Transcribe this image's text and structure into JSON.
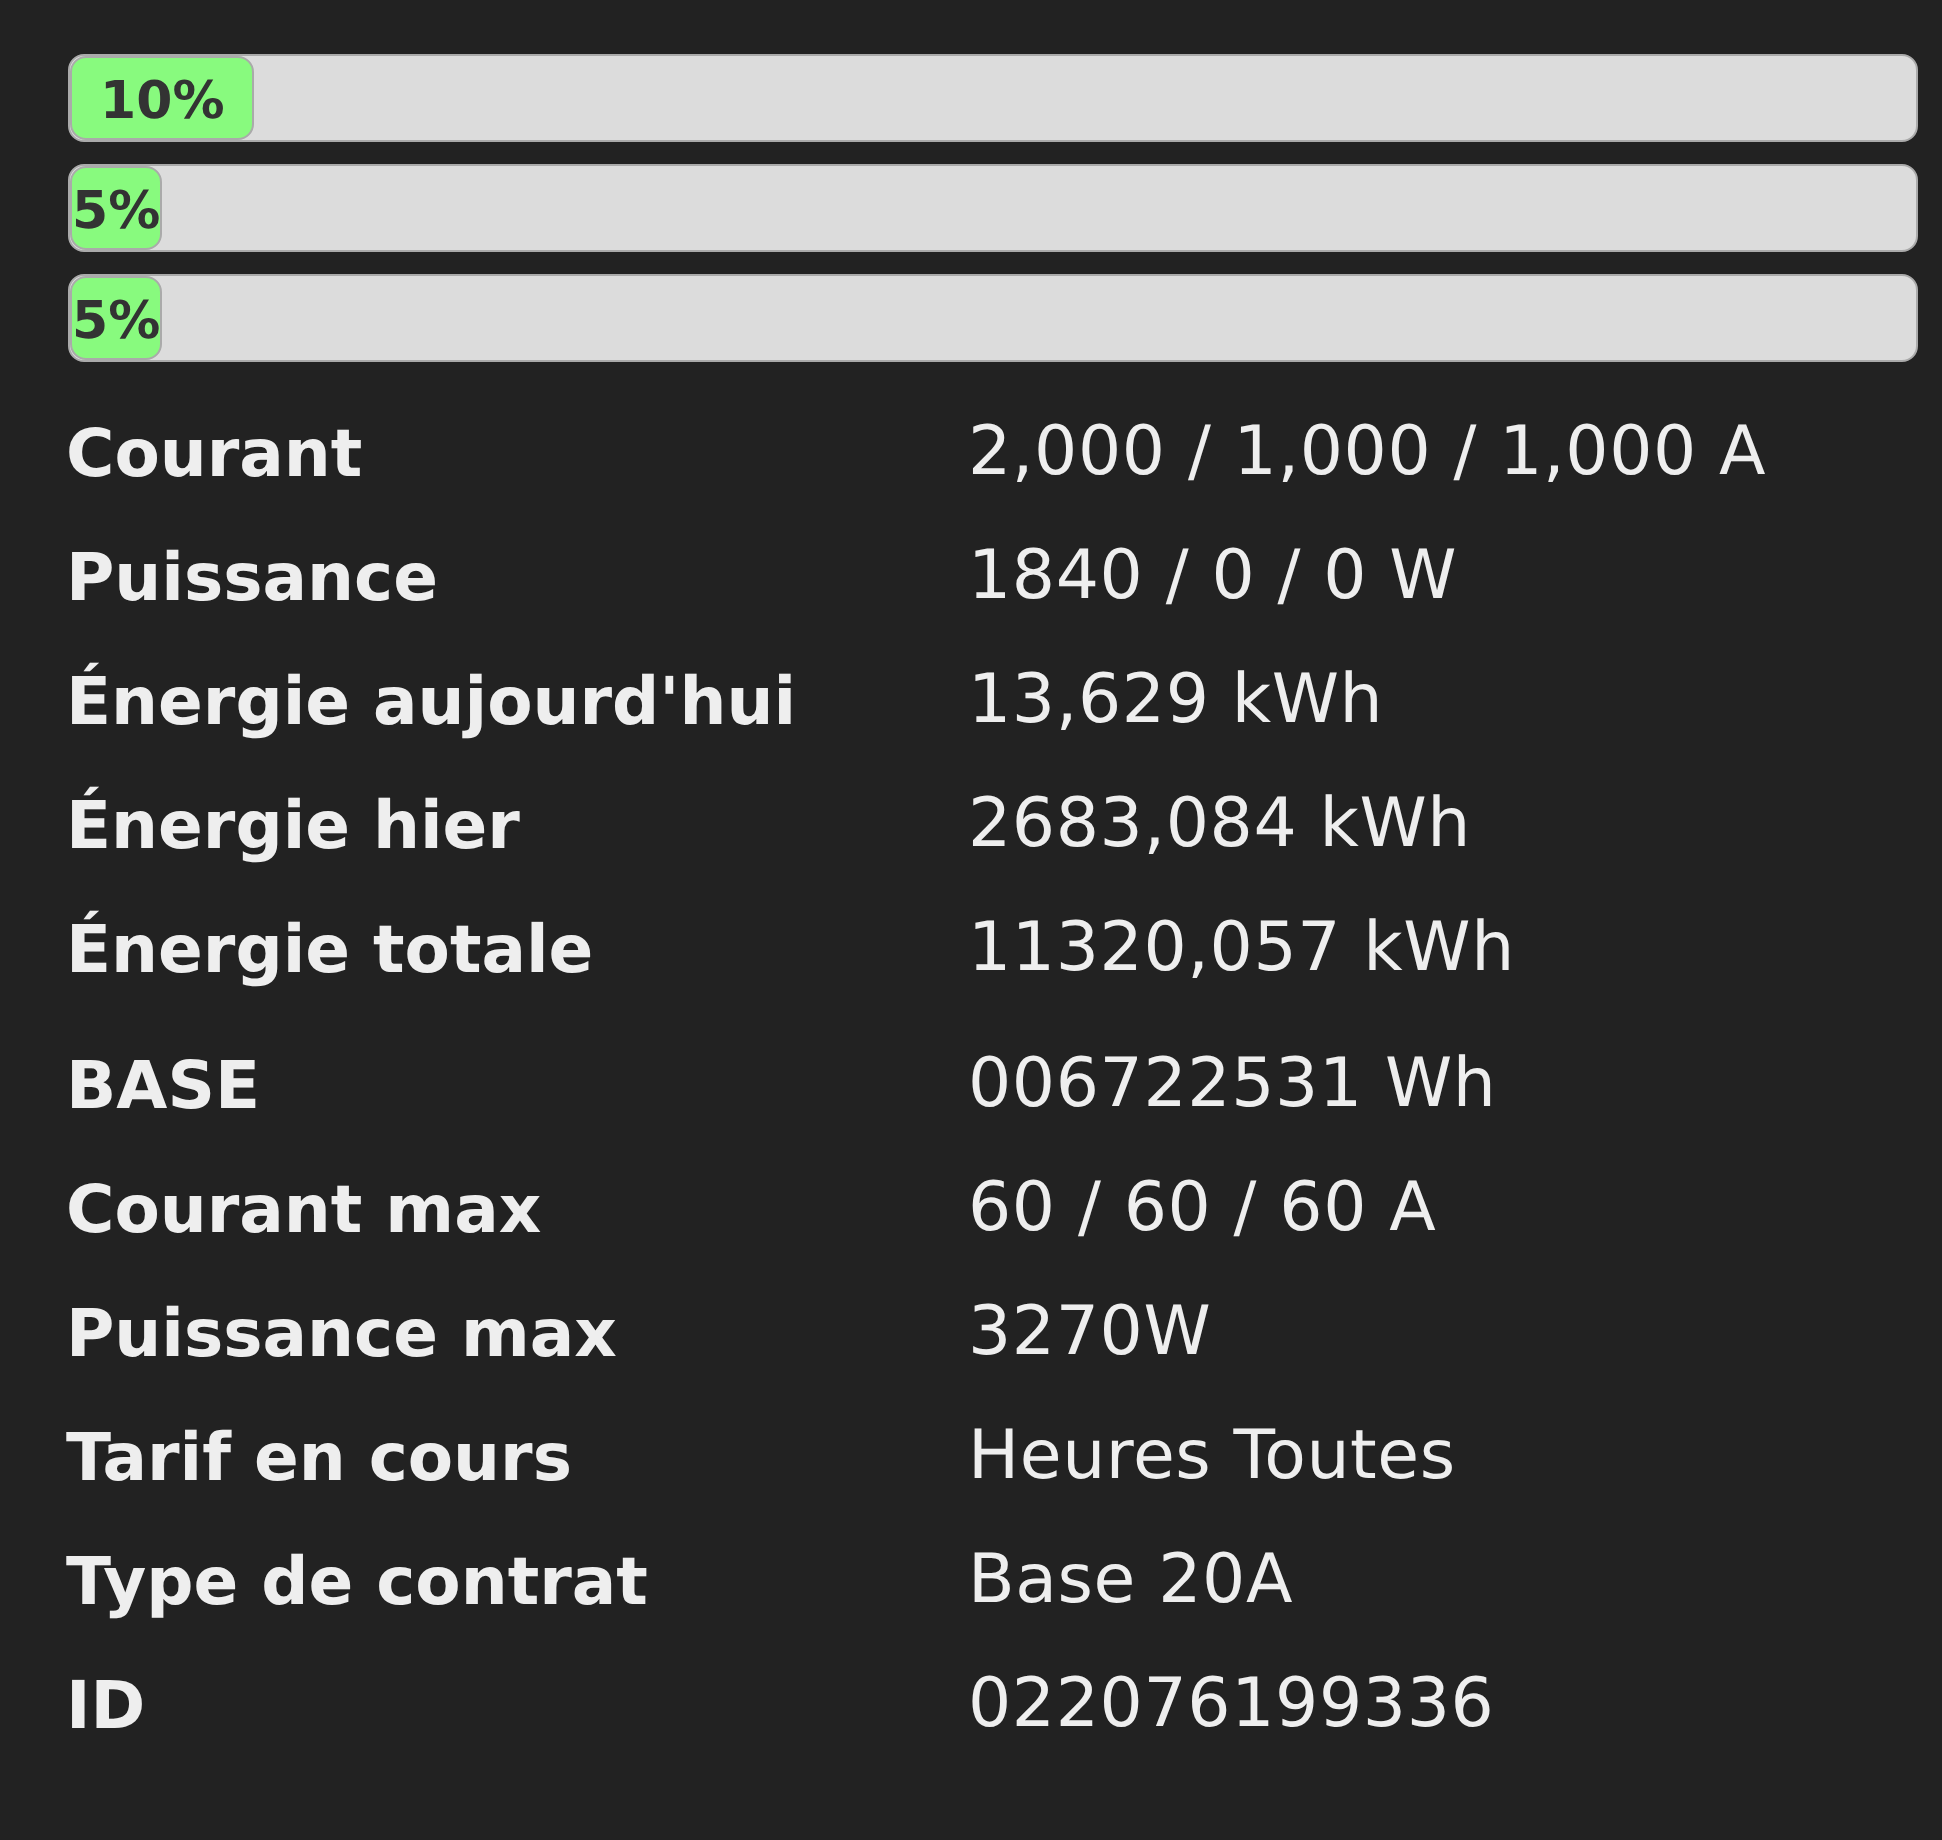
{
  "phases": [
    {
      "label": "10%",
      "level": 0.1
    },
    {
      "label": "5%",
      "level": 0.05
    },
    {
      "label": "5%",
      "level": 0.05
    }
  ],
  "groups": [
    {
      "rows": [
        {
          "name": "Courant",
          "value": "2,000 / 1,000 / 1,000 A"
        },
        {
          "name": "Puissance",
          "value": "1840 / 0 / 0 W"
        },
        {
          "name": "Énergie aujourd'hui",
          "value": "13,629 kWh"
        },
        {
          "name": "Énergie hier",
          "value": "2683,084 kWh"
        },
        {
          "name": "Énergie totale",
          "value": "11320,057 kWh"
        }
      ]
    },
    {
      "rows": [
        {
          "name": "BASE",
          "value": "006722531 Wh"
        },
        {
          "name": "Courant max",
          "value": "60 / 60 / 60 A"
        },
        {
          "name": "Puissance max",
          "value": "3270W"
        },
        {
          "name": "Tarif en cours",
          "value": "Heures Toutes"
        },
        {
          "name": "Type de contrat",
          "value": "Base 20A"
        },
        {
          "name": "ID",
          "value": "022076199336"
        }
      ]
    }
  ]
}
